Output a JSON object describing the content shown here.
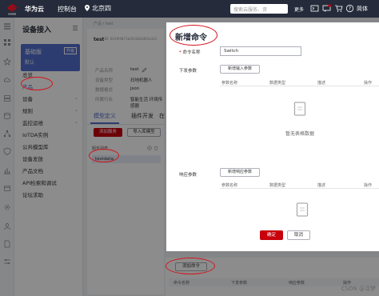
{
  "topbar": {
    "brand": "华为云",
    "console": "控制台",
    "region": "北京四",
    "search_placeholder": "搜索云服务、资",
    "more": "更多",
    "user": "简体"
  },
  "sidebar": {
    "title": "设备接入",
    "edition": {
      "name": "基础版",
      "sub": "默认",
      "tag": "升级"
    },
    "items": [
      {
        "label": "总览"
      },
      {
        "label": "产品"
      },
      {
        "label": "设备"
      },
      {
        "label": "规则"
      },
      {
        "label": "监控运维"
      },
      {
        "label": "IoTDA实例"
      },
      {
        "label": "公共模型库"
      },
      {
        "label": "设备发放"
      },
      {
        "label": "产品文档"
      },
      {
        "label": "API检索和调试"
      },
      {
        "label": "论坛求助"
      }
    ]
  },
  "main": {
    "breadcrumb": "产品 / test",
    "product_name": "test",
    "product_id": "ID: 6019f4871b3fc02b0d92a323",
    "fields": [
      {
        "label": "产品名称",
        "value": "test"
      },
      {
        "label": "设备类型",
        "value": "扫地机器人"
      },
      {
        "label": "数据格式",
        "value": "json"
      },
      {
        "label": "所属行业",
        "value": "智能生活 环境传感器"
      }
    ],
    "tabs": [
      "模型定义",
      "插件开发",
      "在"
    ],
    "add_service": "添加服务",
    "import_model": "导入库模型",
    "service_list_title": "服务列表",
    "service_item": "testdata",
    "add_command": "添加命令",
    "command_table_headers": [
      "命令名称",
      "下发参数",
      "响应参数",
      "操作"
    ],
    "watermark": "CSDN @寻梦"
  },
  "modal": {
    "title": "新增命令",
    "command_name_label": "命令名称",
    "command_name_value": "Switch",
    "down_params_label": "下发参数",
    "add_input_param": "新增输入参数",
    "response_params_label": "响应参数",
    "add_response_param": "新增响应参数",
    "param_headers": [
      "参数名称",
      "数据类型",
      "描述",
      "操作"
    ],
    "empty_text": "暂无表格数据",
    "ok": "确定",
    "cancel": "取消"
  }
}
